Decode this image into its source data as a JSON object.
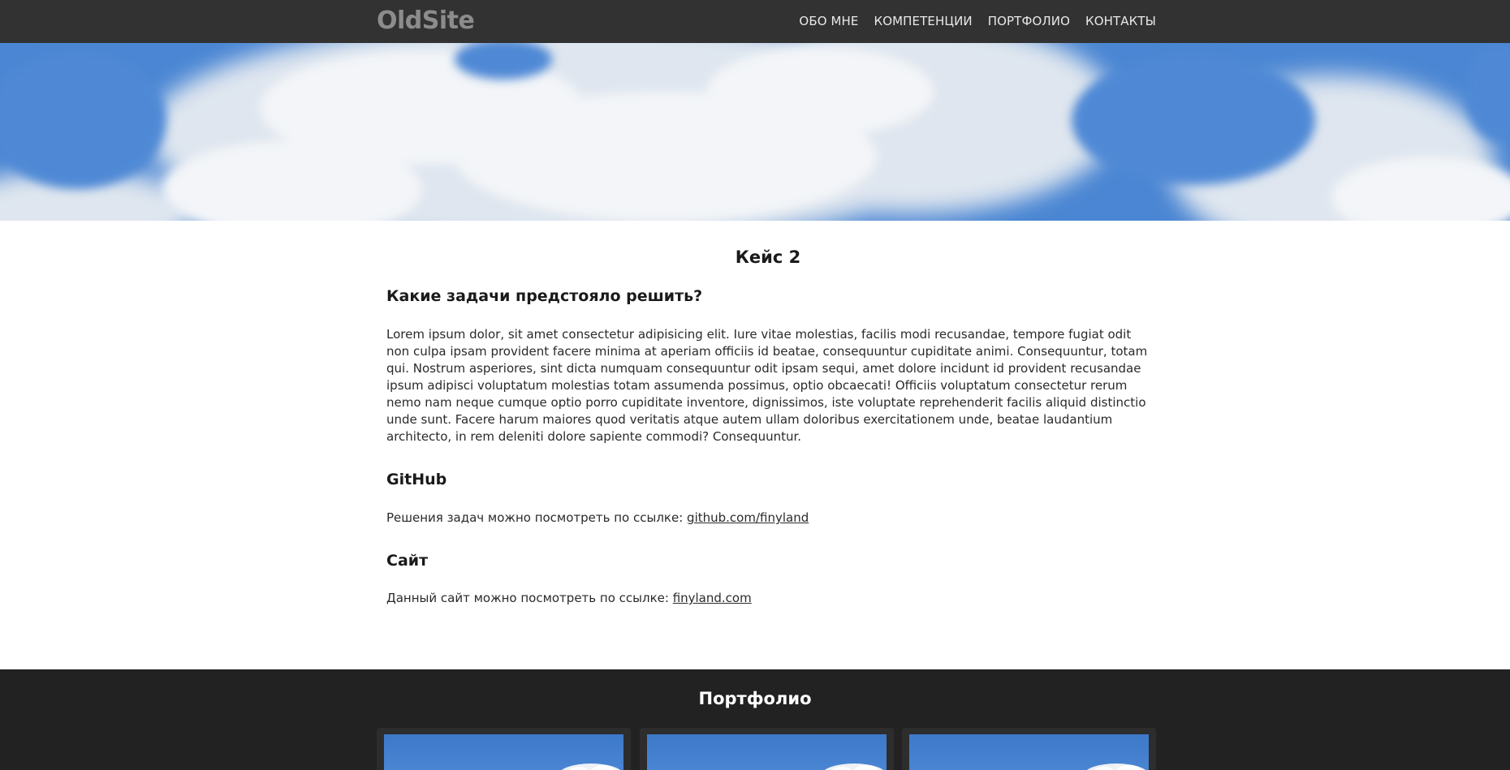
{
  "header": {
    "logo": "OldSite",
    "nav": [
      {
        "label": "Обо мне"
      },
      {
        "label": "Компетенции"
      },
      {
        "label": "Портфолио"
      },
      {
        "label": "Контакты"
      }
    ]
  },
  "case": {
    "title": "Кейс 2",
    "tasks_heading": "Какие задачи предстояло решить?",
    "tasks_text": "Lorem ipsum dolor, sit amet consectetur adipisicing elit. Iure vitae molestias, facilis modi recusandae, tempore fugiat odit non culpa ipsam provident facere minima at aperiam officiis id beatae, consequuntur cupiditate animi. Consequuntur, totam qui. Nostrum asperiores, sint dicta numquam consequuntur odit ipsam sequi, amet dolore incidunt id provident recusandae ipsum adipisci voluptatum molestias totam assumenda possimus, optio obcaecati! Officiis voluptatum consectetur rerum nemo nam neque cumque optio porro cupiditate inventore, dignissimos, iste voluptate reprehenderit facilis aliquid distinctio unde sunt. Facere harum maiores quod veritatis atque autem ullam doloribus exercitationem unde, beatae laudantium architecto, in rem deleniti dolore sapiente commodi? Consequuntur.",
    "github_heading": "GitHub",
    "github_text": "Решения задач можно посмотреть по ссылке: ",
    "github_link": "github.com/finyland",
    "site_heading": "Сайт",
    "site_text": "Данный сайт можно посмотреть по ссылке: ",
    "site_link": "finyland.com"
  },
  "portfolio": {
    "title": "Портфолио"
  },
  "colors": {
    "header_bg": "#323232",
    "footer_bg": "#222222",
    "logo": "#8c8c8c",
    "sky_blue": "#3f7fd4"
  }
}
